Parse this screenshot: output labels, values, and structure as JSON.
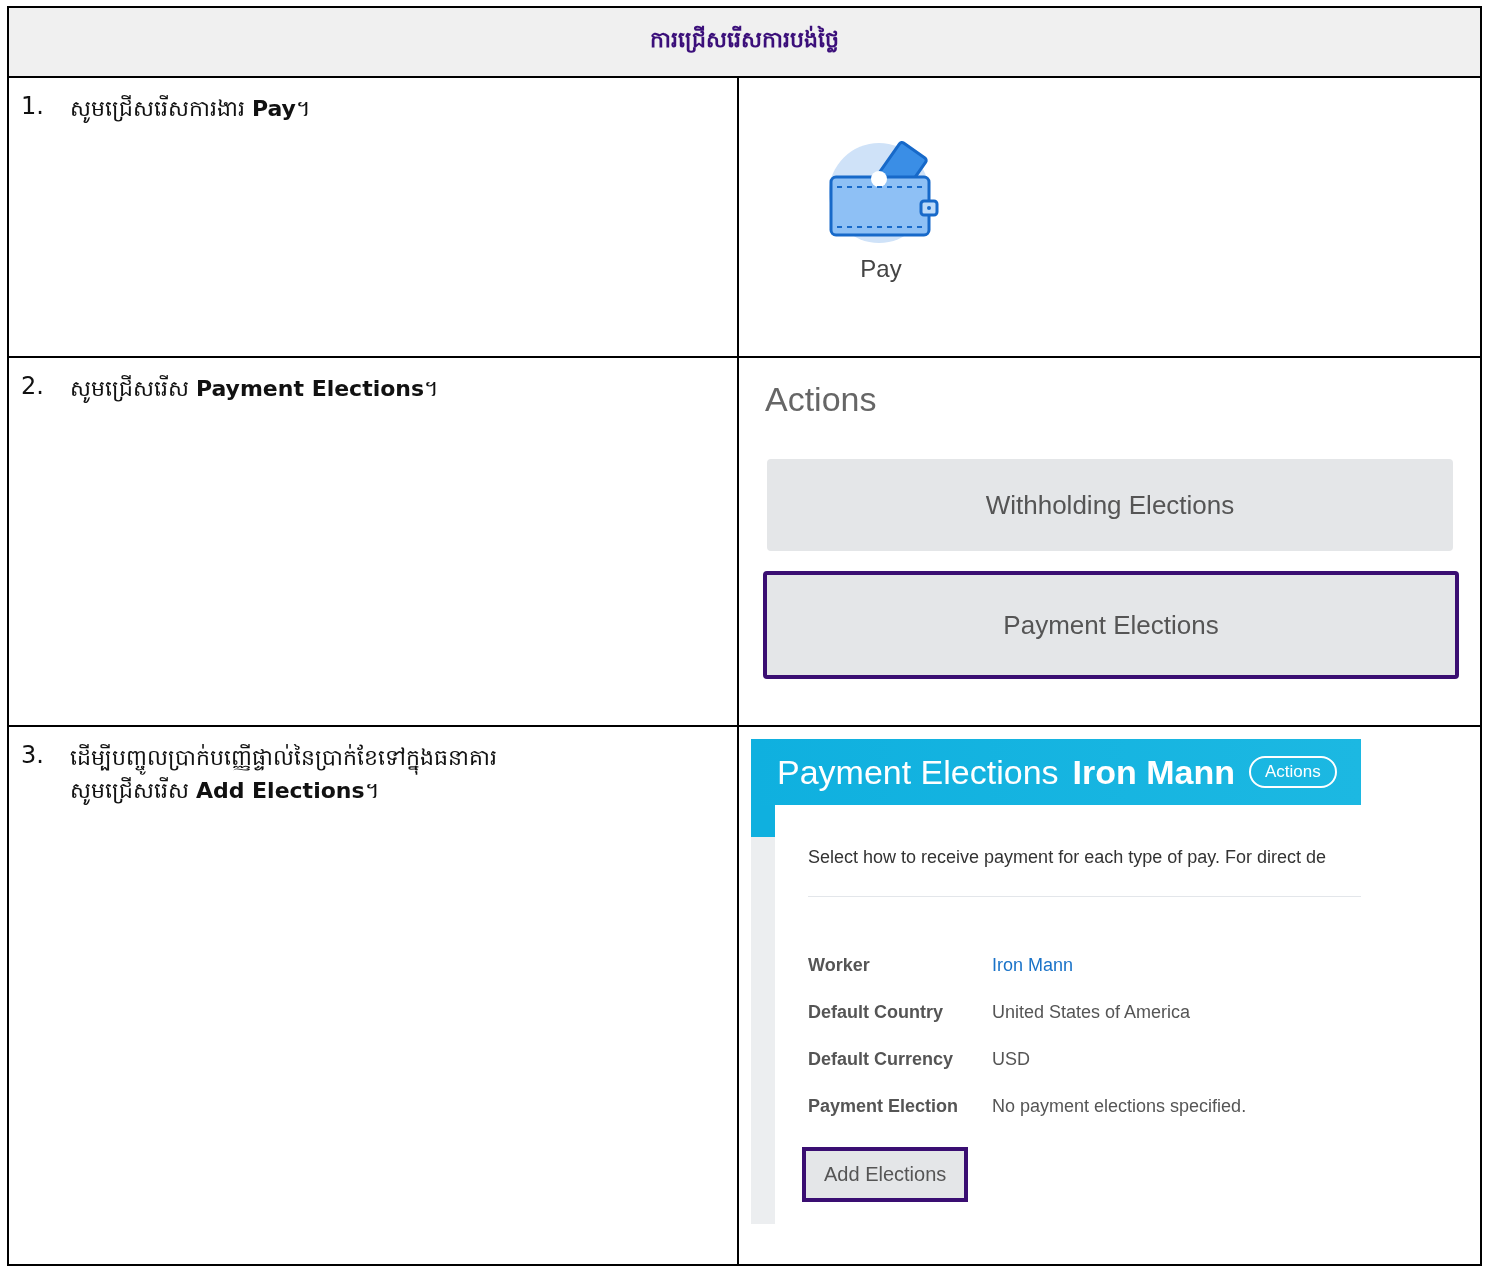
{
  "table": {
    "title": "ការជ្រើសរើសការបង់ថ្លៃ",
    "steps": [
      {
        "number": "1.",
        "instruction": "សូមជ្រើសរើសការងារ **Pay**។",
        "kind": "app-tile",
        "tile": {
          "label": "Pay"
        }
      },
      {
        "number": "2.",
        "instruction": "សូមជ្រើសរើស **Payment Elections**។",
        "kind": "actions",
        "actions": {
          "heading": "Actions",
          "buttons": [
            {
              "label": "Withholding Elections",
              "highlighted": false
            },
            {
              "label": "Payment Elections",
              "highlighted": true
            }
          ]
        }
      },
      {
        "number": "3.",
        "instruction": "ដើម្បីបញ្ចូលប្រាក់បញ្ញើផ្ទាល់នៃប្រាក់ខែទៅក្នុងធនាគារ\nសូមជ្រើសរើស **Add Elections**។",
        "kind": "elections-page",
        "page": {
          "title": "Payment Elections",
          "worker_name": "Iron Mann",
          "actions_button": "Actions",
          "intro": "Select how to receive payment for each type of pay. For direct de",
          "fields": [
            {
              "label": "Worker",
              "value": "Iron Mann",
              "kind": "link"
            },
            {
              "label": "Default Country",
              "value": "United States of America",
              "kind": "text"
            },
            {
              "label": "Default Currency",
              "value": "USD",
              "kind": "text"
            },
            {
              "label": "Payment Election",
              "value": "No payment elections specified.",
              "kind": "text"
            }
          ],
          "button": {
            "label": "Add Elections",
            "highlighted": true
          }
        }
      }
    ]
  }
}
